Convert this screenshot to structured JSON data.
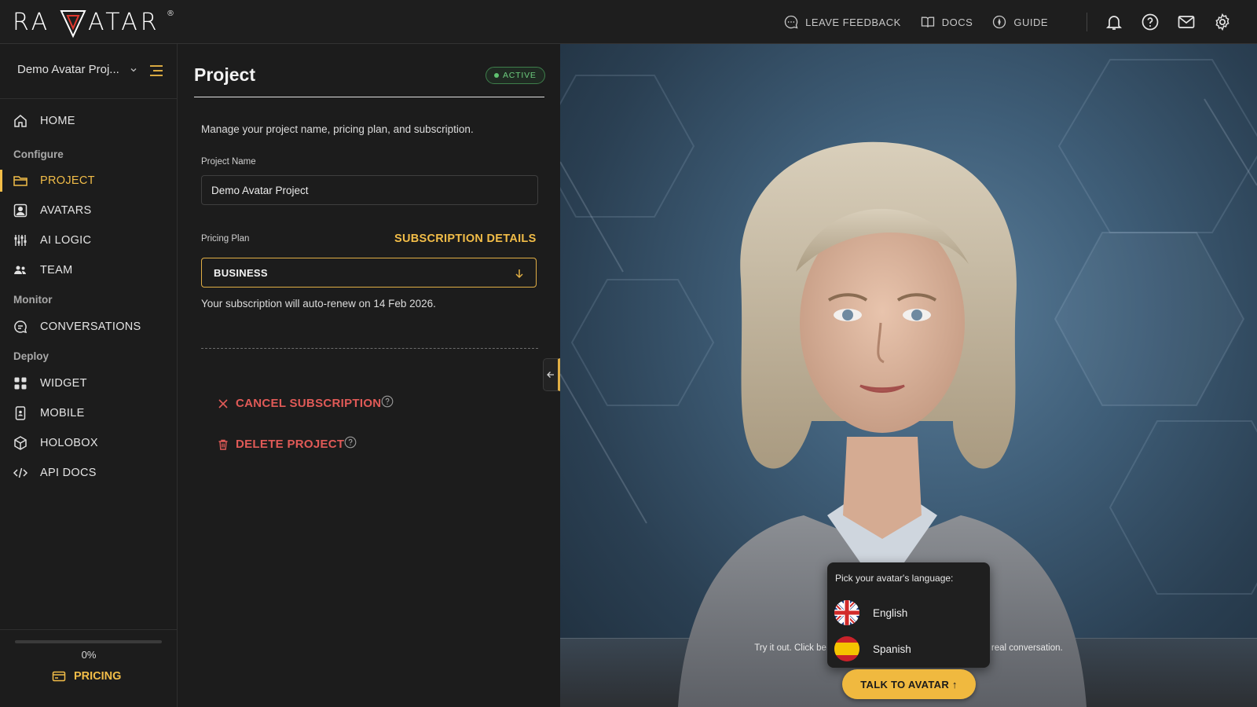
{
  "brand": {
    "name": "RAVATAR",
    "reg": "®",
    "accent": "#f2bd48"
  },
  "topbar": {
    "links": [
      {
        "label": "LEAVE FEEDBACK",
        "icon": "feedback-icon"
      },
      {
        "label": "DOCS",
        "icon": "book-icon"
      },
      {
        "label": "GUIDE",
        "icon": "compass-icon"
      }
    ],
    "icons": [
      "bell-icon",
      "help-icon",
      "mail-icon",
      "gear-icon"
    ]
  },
  "sidebar": {
    "project_selector": "Demo Avatar Proj...",
    "home": "HOME",
    "sections": {
      "configure": "Configure",
      "monitor": "Monitor",
      "deploy": "Deploy"
    },
    "items": {
      "project": "PROJECT",
      "avatars": "AVATARS",
      "ai_logic": "AI LOGIC",
      "team": "TEAM",
      "conversations": "CONVERSATIONS",
      "widget": "WIDGET",
      "mobile": "MOBILE",
      "holobox": "HOLOBOX",
      "api_docs": "API DOCS"
    },
    "progress": {
      "value": 0,
      "label": "0%"
    },
    "pricing": "PRICING"
  },
  "main": {
    "title": "Project",
    "status": "ACTIVE",
    "description": "Manage your project name, pricing plan, and subscription.",
    "project_name_label": "Project Name",
    "project_name_value": "Demo Avatar Project",
    "pricing_plan_label": "Pricing Plan",
    "subscription_details": "SUBSCRIPTION DETAILS",
    "plan_value": "BUSINESS",
    "renew_text": "Your subscription will auto-renew on 14 Feb 2026.",
    "cancel_subscription": "CANCEL SUBSCRIPTION",
    "delete_project": "DELETE PROJECT"
  },
  "preview": {
    "hint_left": "Try it out. Click be",
    "hint_right": "real conversation.",
    "language_prompt": "Pick your avatar's language:",
    "languages": [
      "English",
      "Spanish"
    ],
    "talk_button": "TALK TO AVATAR ↑"
  }
}
